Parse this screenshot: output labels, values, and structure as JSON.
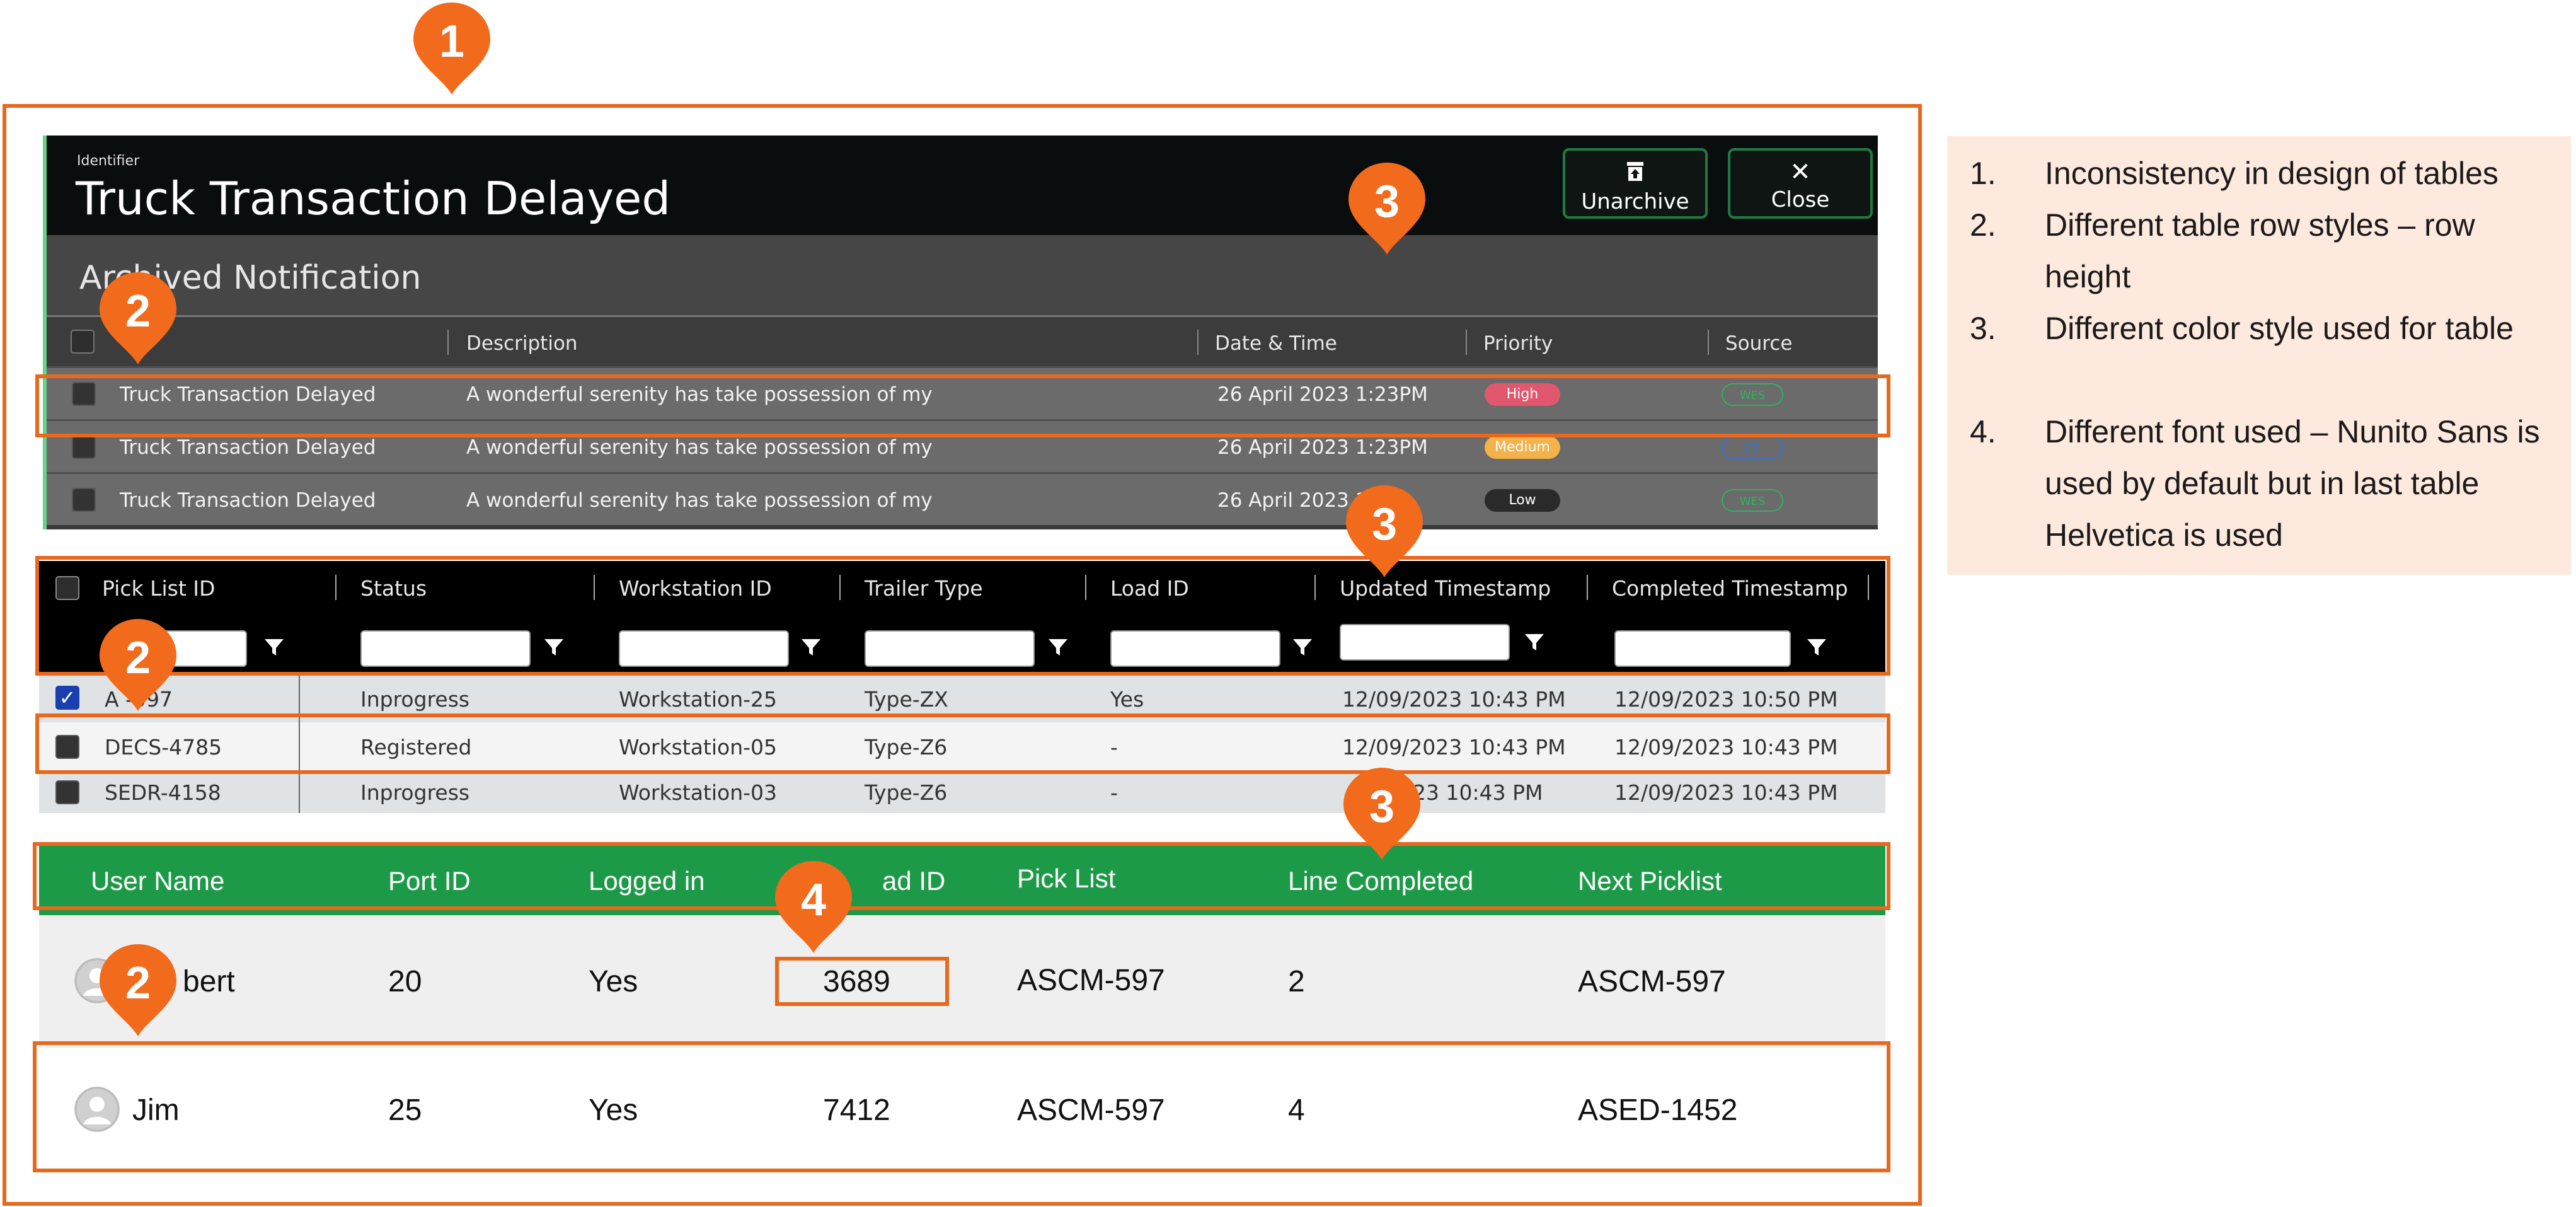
{
  "table1": {
    "identifier_label": "Identifier",
    "title": "Truck Transaction Delayed",
    "buttons": {
      "unarchive": "Unarchive",
      "close": "Close"
    },
    "subtitle": "Archived Notification",
    "columns": [
      "Description",
      "Date & Time",
      "Priority",
      "Source"
    ],
    "rows": [
      {
        "name": "Truck Transaction Delayed",
        "description": "A wonderful serenity has take possession of my",
        "datetime": "26 April 2023 1:23PM",
        "priority": "High",
        "source": "WES"
      },
      {
        "name": "Truck Transaction Delayed",
        "description": "A wonderful serenity has take possession of my",
        "datetime": "26 April 2023 1:23PM",
        "priority": "Medium",
        "source": "CT"
      },
      {
        "name": "Truck Transaction Delayed",
        "description": "A wonderful serenity has take possession of my",
        "datetime": "26 April 2023 1",
        "priority": "Low",
        "source": "WES"
      }
    ],
    "colors": {
      "high": "#e0576e",
      "medium": "#f3b24a",
      "low": "#2a2a2a",
      "source_wes": "#2fb35f",
      "source_ct": "#3a6fd1",
      "accent": "#6bd08c"
    }
  },
  "table2": {
    "columns": [
      "Pick List ID",
      "Status",
      "Workstation ID",
      "Trailer Type",
      "Load ID",
      "Updated Timestamp",
      "Completed Timestamp"
    ],
    "rows": [
      {
        "checked": true,
        "id": "ASCM-597",
        "status": "Inprogress",
        "workstation": "Workstation-25",
        "trailer": "Type-ZX",
        "load": "Yes",
        "updated": "12/09/2023 10:43 PM",
        "completed": "12/09/2023 10:50 PM"
      },
      {
        "checked": false,
        "id": "DECS-4785",
        "status": "Registered",
        "workstation": "Workstation-05",
        "trailer": "Type-Z6",
        "load": "-",
        "updated": "12/09/2023 10:43 PM",
        "completed": "12/09/2023 10:43 PM"
      },
      {
        "checked": false,
        "id": "SEDR-4158",
        "status": "Inprogress",
        "workstation": "Workstation-03",
        "trailer": "Type-Z6",
        "load": "-",
        "updated": "12/09/2023 10:43 PM",
        "completed": "12/09/2023 10:43 PM"
      }
    ],
    "visible_fragments": {
      "row1_id": "A   -597",
      "row3_updated": "23 10:43 PM"
    }
  },
  "table3": {
    "columns": [
      "User Name",
      "Port ID",
      "Logged in",
      "Load ID",
      "Pick List",
      "Line Completed",
      "Next Picklist"
    ],
    "visible_column_fragments": {
      "load_id": "ad ID"
    },
    "rows": [
      {
        "user": "Robert",
        "user_visible": "bert",
        "port": "20",
        "logged": "Yes",
        "load": "3689",
        "picklist": "ASCM-597",
        "lines": "2",
        "next": "ASCM-597"
      },
      {
        "user": "Jim",
        "port": "25",
        "logged": "Yes",
        "load": "7412",
        "picklist": "ASCM-597",
        "lines": "4",
        "next": "ASED-1452"
      }
    ],
    "colors": {
      "header": "#1d9a47"
    }
  },
  "callouts": [
    "1",
    "2",
    "3",
    "4"
  ],
  "notes": [
    {
      "num": "1.",
      "text": "Inconsistency in design of tables"
    },
    {
      "num": "2.",
      "text": "Different table row styles –  row height"
    },
    {
      "num": "3.",
      "text": "Different color style used for table"
    },
    {
      "num": "4.",
      "text": "Different font used – Nunito Sans is used by default but in last table Helvetica is used"
    }
  ],
  "colors": {
    "annotation_orange": "#e8681e",
    "notes_bg": "#fde9dd"
  }
}
